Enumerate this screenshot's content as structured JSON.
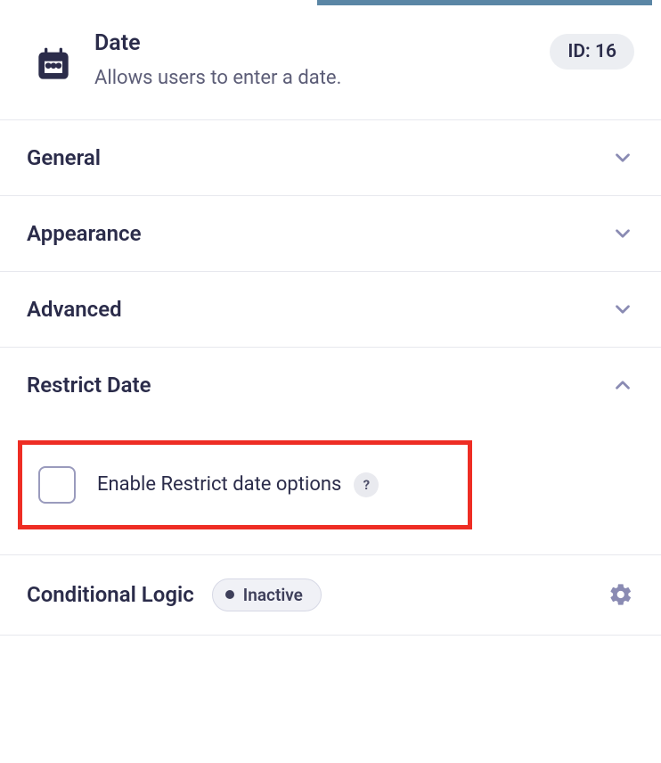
{
  "header": {
    "title": "Date",
    "description": "Allows users to enter a date.",
    "id_label": "ID: 16"
  },
  "sections": {
    "general": "General",
    "appearance": "Appearance",
    "advanced": "Advanced",
    "restrict": "Restrict Date"
  },
  "restrict_option": {
    "checkbox_label": "Enable Restrict date options",
    "help_symbol": "?"
  },
  "conditional": {
    "label": "Conditional Logic",
    "status": "Inactive"
  }
}
